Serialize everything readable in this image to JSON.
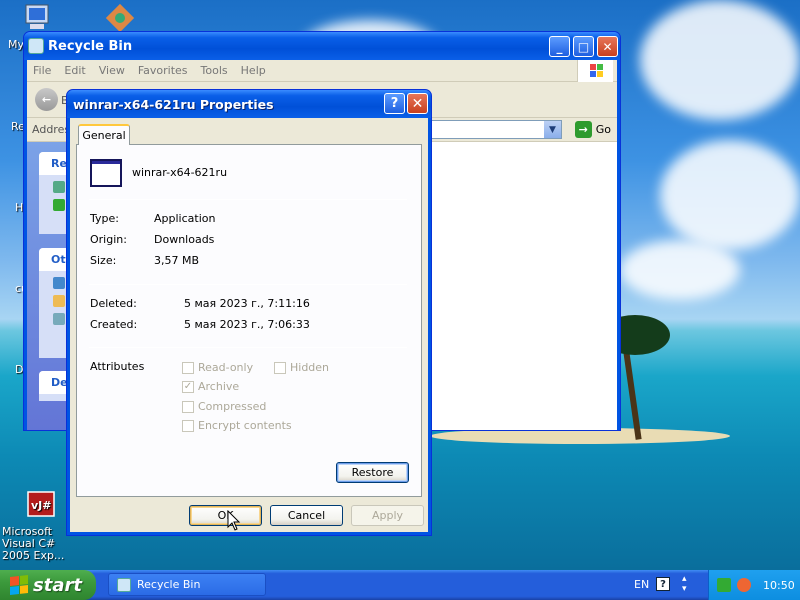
{
  "desktop": {
    "icons": [
      {
        "label": "My",
        "icon": "my-computer-icon"
      },
      {
        "label": "Microsoft Visual C# 2005 Exp...",
        "icon": "visual-csharp-icon"
      }
    ],
    "partial_labels": [
      "Re",
      "H",
      "cu",
      "D"
    ]
  },
  "recycle_window": {
    "title": "Recycle Bin",
    "menu": [
      "File",
      "Edit",
      "View",
      "Favorites",
      "Tools",
      "Help"
    ],
    "back_label": "B",
    "address_label": "Addres",
    "go_label": "Go",
    "taskpane_headers": [
      "Re",
      "Otl",
      "De"
    ]
  },
  "dialog": {
    "title": "winrar-x64-621ru Properties",
    "help_symbol": "?",
    "close_symbol": "✕",
    "tab_label": "General",
    "file_name": "winrar-x64-621ru",
    "fields": {
      "type_label": "Type:",
      "type_value": "Application",
      "origin_label": "Origin:",
      "origin_value": "Downloads",
      "size_label": "Size:",
      "size_value": "3,57 MB",
      "deleted_label": "Deleted:",
      "deleted_value": "5 мая 2023 г., 7:11:16",
      "created_label": "Created:",
      "created_value": "5 мая 2023 г., 7:06:33",
      "attributes_label": "Attributes"
    },
    "attributes": {
      "readonly": "Read-only",
      "hidden": "Hidden",
      "archive": "Archive",
      "compressed": "Compressed",
      "encrypt": "Encrypt contents",
      "archive_checked": true
    },
    "buttons": {
      "restore": "Restore",
      "ok": "OK",
      "cancel": "Cancel",
      "apply": "Apply"
    }
  },
  "taskbar": {
    "start_label": "start",
    "task_item": "Recycle Bin",
    "lang": "EN",
    "lang_help": "?",
    "clock": "10:50"
  }
}
